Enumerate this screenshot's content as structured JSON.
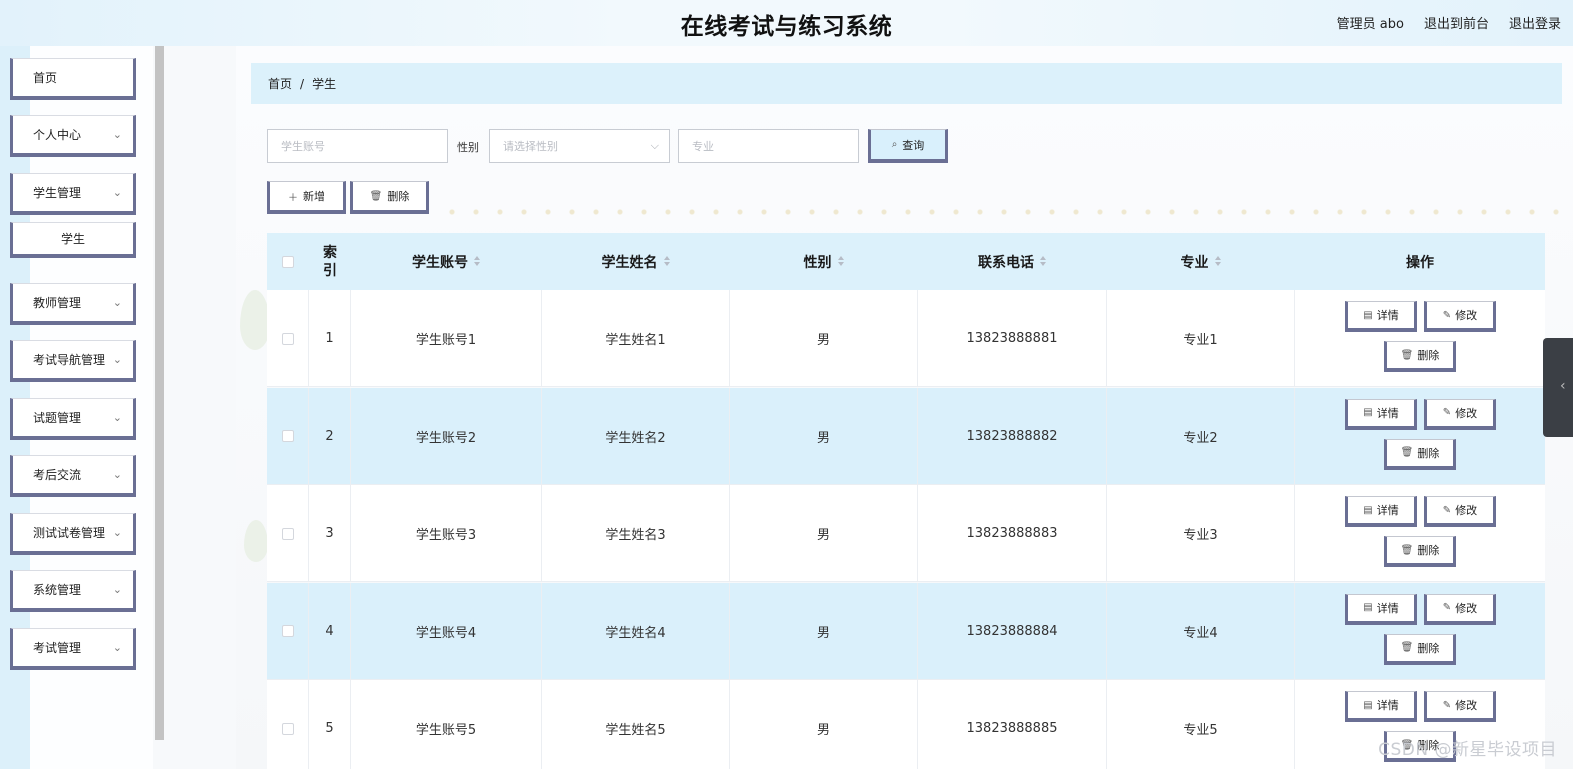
{
  "app": {
    "title": "在线考试与练习系统",
    "user_label": "管理员 abo",
    "front_link": "退出到前台",
    "logout_link": "退出登录"
  },
  "sidebar": {
    "items": [
      {
        "label": "首页",
        "chevron": ""
      },
      {
        "label": "个人中心",
        "chevron": "⌄"
      },
      {
        "label": "学生管理",
        "chevron": "⌄"
      },
      {
        "label": "学生",
        "chevron": ""
      },
      {
        "label": "教师管理",
        "chevron": "⌄"
      },
      {
        "label": "考试导航管理",
        "chevron": "⌄"
      },
      {
        "label": "试题管理",
        "chevron": "⌄"
      },
      {
        "label": "考后交流",
        "chevron": "⌄"
      },
      {
        "label": "测试试卷管理",
        "chevron": "⌄"
      },
      {
        "label": "系统管理",
        "chevron": "⌄"
      },
      {
        "label": "考试管理",
        "chevron": "⌄"
      }
    ]
  },
  "breadcrumb": {
    "home": "首页",
    "sep": "/",
    "current": "学生"
  },
  "search": {
    "account_placeholder": "学生账号",
    "gender_label": "性别",
    "gender_placeholder": "请选择性别",
    "major_placeholder": "专业",
    "query_label": "查询"
  },
  "actions": {
    "add_label": "新增",
    "delete_label": "删除"
  },
  "table": {
    "headers": {
      "index": "索引",
      "account": "学生账号",
      "name": "学生姓名",
      "gender": "性别",
      "phone": "联系电话",
      "major": "专业",
      "ops": "操作"
    },
    "rows": [
      {
        "index": "1",
        "account": "学生账号1",
        "name": "学生姓名1",
        "gender": "男",
        "phone": "13823888881",
        "major": "专业1"
      },
      {
        "index": "2",
        "account": "学生账号2",
        "name": "学生姓名2",
        "gender": "男",
        "phone": "13823888882",
        "major": "专业2"
      },
      {
        "index": "3",
        "account": "学生账号3",
        "name": "学生姓名3",
        "gender": "男",
        "phone": "13823888883",
        "major": "专业3"
      },
      {
        "index": "4",
        "account": "学生账号4",
        "name": "学生姓名4",
        "gender": "男",
        "phone": "13823888884",
        "major": "专业4"
      },
      {
        "index": "5",
        "account": "学生账号5",
        "name": "学生姓名5",
        "gender": "男",
        "phone": "13823888885",
        "major": "专业5"
      }
    ],
    "row_actions": {
      "detail": "详情",
      "edit": "修改",
      "delete": "删除"
    }
  },
  "watermark": "CSDN @新星毕设项目",
  "icons": {
    "search": "search-icon",
    "plus": "plus-icon",
    "trash": "trash-icon",
    "doc": "document-icon",
    "pen": "edit-icon",
    "chevron": "chevron-down-icon"
  },
  "colors": {
    "accent": "#6a6f94",
    "header_bg": "#dcf1fb"
  }
}
